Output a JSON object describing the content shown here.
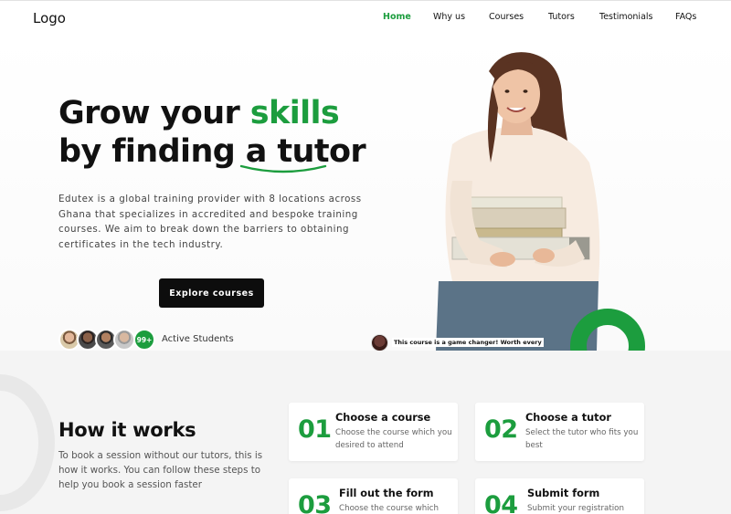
{
  "nav": {
    "logo": "Logo",
    "items": [
      {
        "label": "Home",
        "active": true
      },
      {
        "label": "Why us",
        "active": false
      },
      {
        "label": "Courses",
        "active": false
      },
      {
        "label": "Tutors",
        "active": false
      },
      {
        "label": "Testimonials",
        "active": false
      },
      {
        "label": "FAQs",
        "active": false
      }
    ]
  },
  "hero": {
    "title_part1": "Grow your ",
    "title_highlight": "skills",
    "title_line2": "by finding a tutor",
    "description": "Edutex is a global training provider with 8 locations across Ghana that specializes in accredited and bespoke training courses. We aim to break down the barriers to obtaining certificates in the tech industry.",
    "cta_label": "Explore courses",
    "students_count": "99+",
    "students_label": "Active Students",
    "testimonial": "This course is a game changer! Worth every"
  },
  "how": {
    "title": "How it works",
    "description": "To book a session without our tutors, this is how it works. You can follow these steps to help you book a session faster",
    "steps": [
      {
        "num": "01",
        "title": "Choose a course",
        "desc": "Choose the course which you desired to attend"
      },
      {
        "num": "02",
        "title": "Choose a tutor",
        "desc": "Select the tutor who fits you best"
      },
      {
        "num": "03",
        "title": "Fill out the form",
        "desc": "Choose the course which"
      },
      {
        "num": "04",
        "title": "Submit form",
        "desc": "Submit your registration"
      }
    ]
  },
  "colors": {
    "accent": "#1c9d3e",
    "button": "#0d0d0d",
    "section_bg": "#f4f4f4"
  }
}
